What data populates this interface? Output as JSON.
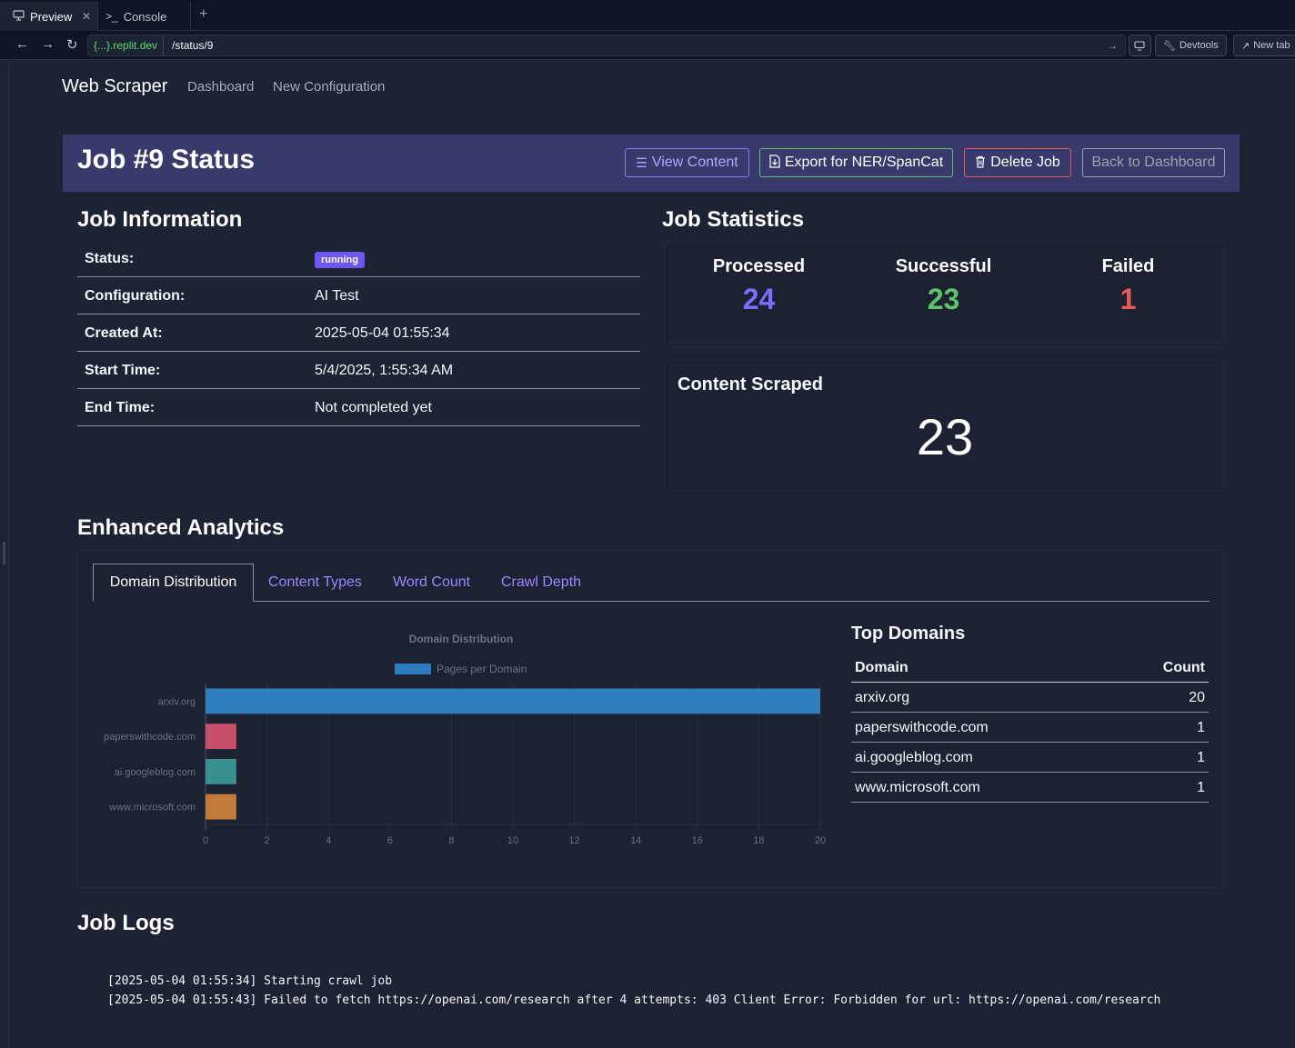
{
  "browser": {
    "tabs": [
      {
        "label": "Preview",
        "icon": "monitor-icon"
      },
      {
        "label": "Console",
        "icon": "terminal-icon"
      }
    ],
    "url_host": "{...}.replit.dev",
    "url_path": "/status/9",
    "devtools_label": "Devtools",
    "newtab_label": "New tab"
  },
  "nav": {
    "brand": "Web Scraper",
    "links": [
      "Dashboard",
      "New Configuration"
    ]
  },
  "header": {
    "title": "Job #9 Status",
    "buttons": {
      "view": "View Content",
      "export": "Export for NER/SpanCat",
      "delete": "Delete Job",
      "back": "Back to Dashboard"
    },
    "colors": {
      "band": "#373a6b",
      "view": "#8b7bff",
      "export": "#5bc46a",
      "delete": "#ea5959",
      "back": "#9ca3af"
    }
  },
  "job_info": {
    "title": "Job Information",
    "rows": [
      {
        "key": "Status:",
        "value": "running"
      },
      {
        "key": "Configuration:",
        "value": "AI Test"
      },
      {
        "key": "Created At:",
        "value": "2025-05-04 01:55:34"
      },
      {
        "key": "Start Time:",
        "value": "5/4/2025, 1:55:34 AM"
      },
      {
        "key": "End Time:",
        "value": "Not completed yet"
      }
    ]
  },
  "job_stats": {
    "title": "Job Statistics",
    "processed": {
      "label": "Processed",
      "value": "24",
      "color": "#7c6cff"
    },
    "successful": {
      "label": "Successful",
      "value": "23",
      "color": "#5bc46a"
    },
    "failed": {
      "label": "Failed",
      "value": "1",
      "color": "#ea5959"
    },
    "content_scraped": {
      "label": "Content Scraped",
      "value": "23"
    }
  },
  "analytics": {
    "title": "Enhanced Analytics",
    "tabs": [
      "Domain Distribution",
      "Content Types",
      "Word Count",
      "Crawl Depth"
    ],
    "active_tab": "Domain Distribution"
  },
  "chart_data": {
    "type": "bar",
    "orientation": "horizontal",
    "title": "Domain Distribution",
    "categories": [
      "arxiv.org",
      "paperswithcode.com",
      "ai.googleblog.com",
      "www.microsoft.com"
    ],
    "series": [
      {
        "name": "Pages per Domain",
        "values": [
          20,
          1,
          1,
          1
        ]
      }
    ],
    "bar_colors": [
      "#2e7dbd",
      "#c74f6b",
      "#3a8f8f",
      "#c27a3a"
    ],
    "xlim": [
      0,
      20
    ],
    "xticks": [
      0,
      2,
      4,
      6,
      8,
      10,
      12,
      14,
      16,
      18,
      20
    ],
    "legend": "top",
    "grid": true
  },
  "top_domains": {
    "title": "Top Domains",
    "header": {
      "domain": "Domain",
      "count": "Count"
    },
    "rows": [
      {
        "domain": "arxiv.org",
        "count": "20"
      },
      {
        "domain": "paperswithcode.com",
        "count": "1"
      },
      {
        "domain": "ai.googleblog.com",
        "count": "1"
      },
      {
        "domain": "www.microsoft.com",
        "count": "1"
      }
    ]
  },
  "logs": {
    "title": "Job Logs",
    "lines": [
      "[2025-05-04 01:55:34] Starting crawl job",
      "[2025-05-04 01:55:43] Failed to fetch https://openai.com/research after 4 attempts: 403 Client Error: Forbidden for url: https://openai.com/research"
    ]
  }
}
